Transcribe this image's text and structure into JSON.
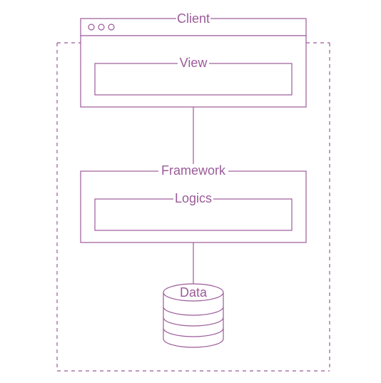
{
  "diagram": {
    "client_label": "Client",
    "view_label": "View",
    "framework_label": "Framework",
    "logics_label": "Logics",
    "data_label": "Data"
  }
}
